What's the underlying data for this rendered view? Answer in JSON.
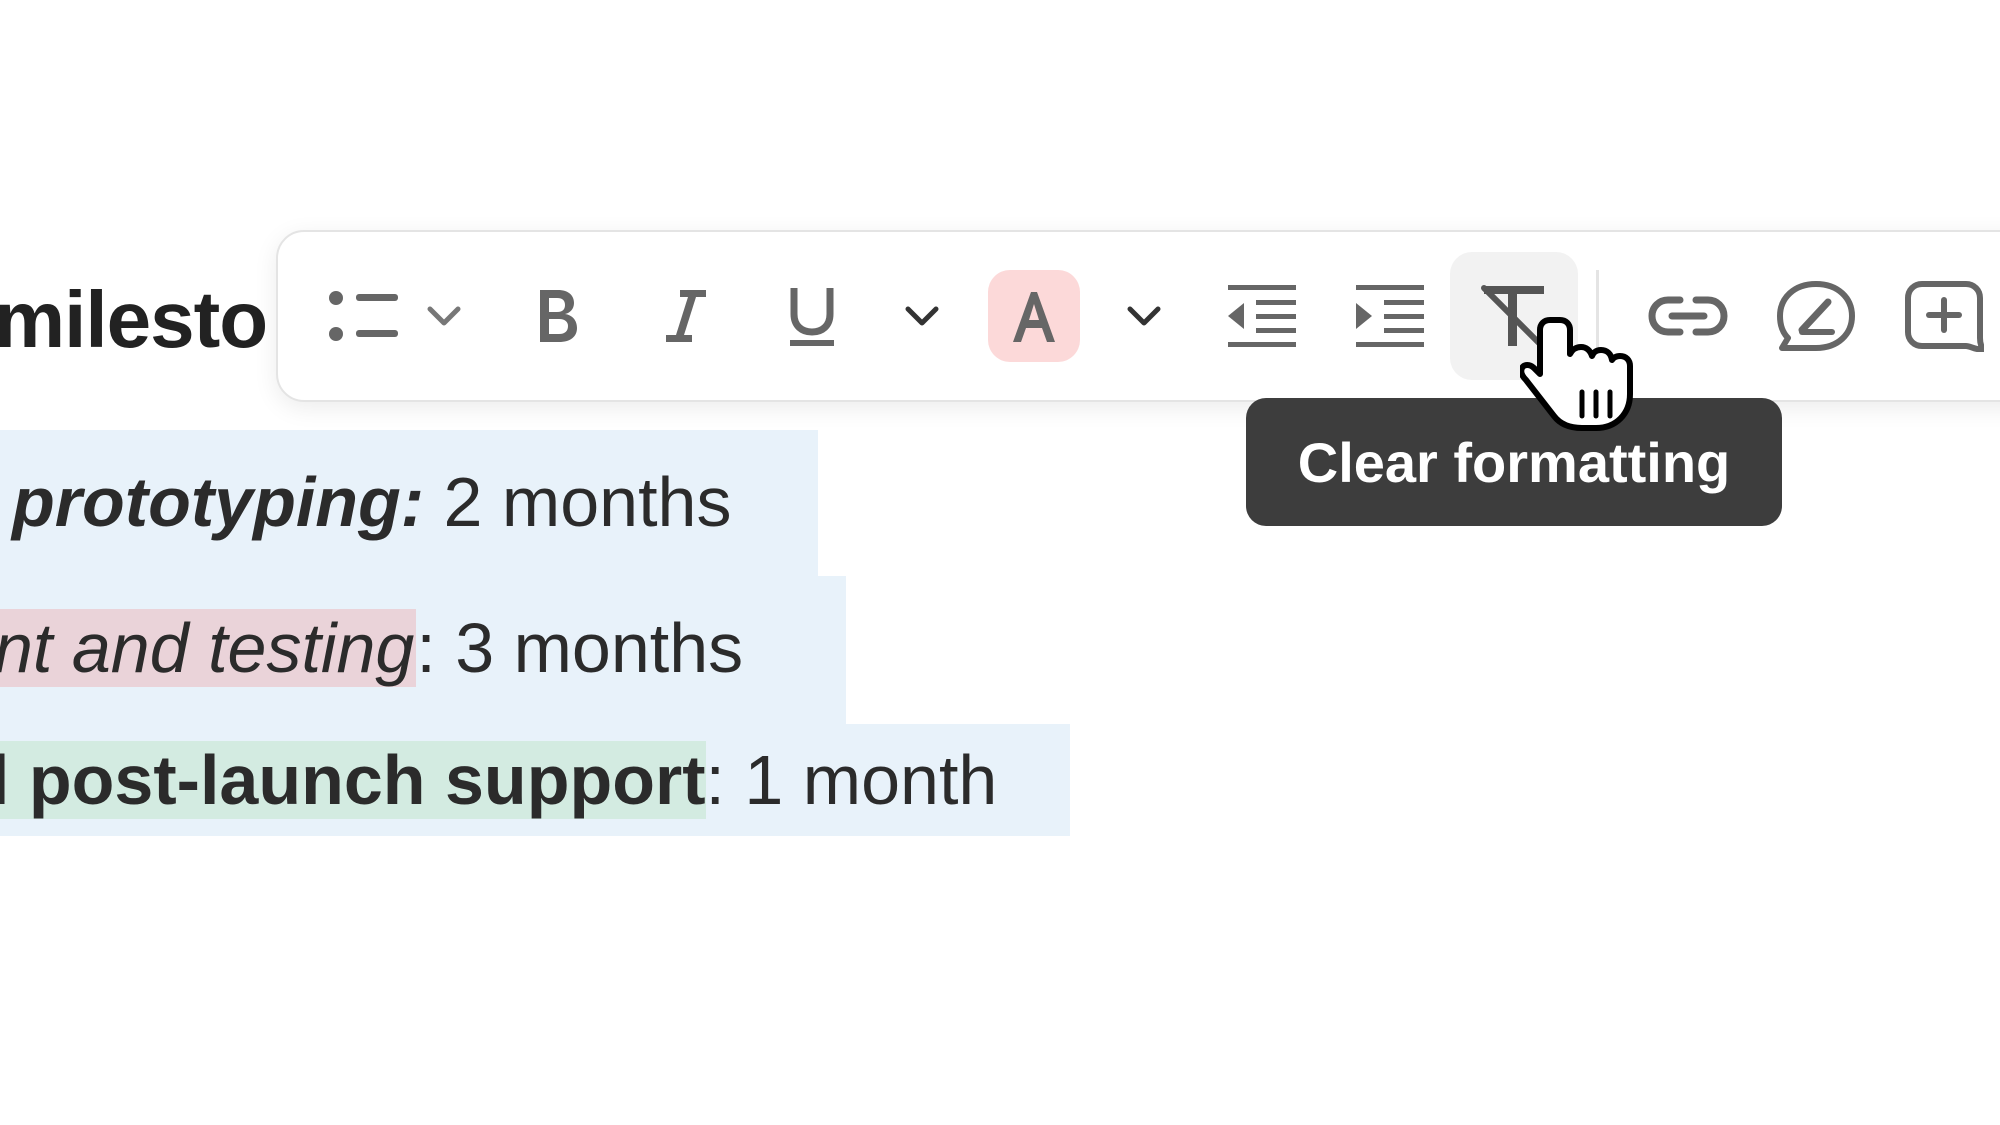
{
  "document": {
    "heading": "milesto",
    "lines": [
      {
        "label": " prototyping:",
        "value": " 2 months"
      },
      {
        "label": "nt and testing",
        "sep": ":",
        "value": " 3 months"
      },
      {
        "label": "l post-launch support",
        "sep": ":",
        "value": " 1 month"
      }
    ]
  },
  "toolbar": {
    "buttons": [
      {
        "name": "bulleted-list",
        "icon": "bullet-list-icon"
      },
      {
        "name": "list-options",
        "icon": "chevron-down-icon"
      },
      {
        "name": "bold",
        "icon": "bold-icon"
      },
      {
        "name": "italic",
        "icon": "italic-icon"
      },
      {
        "name": "underline",
        "icon": "underline-icon"
      },
      {
        "name": "text-style-options",
        "icon": "chevron-down-icon"
      },
      {
        "name": "text-color",
        "icon": "text-color-icon",
        "swatch": "#fcd9d9"
      },
      {
        "name": "text-color-options",
        "icon": "chevron-down-icon"
      },
      {
        "name": "outdent",
        "icon": "outdent-icon"
      },
      {
        "name": "indent",
        "icon": "indent-icon"
      },
      {
        "name": "clear-formatting",
        "icon": "clear-formatting-icon",
        "state": "hovered"
      },
      {
        "name": "link",
        "icon": "link-icon"
      },
      {
        "name": "comment-edit",
        "icon": "edit-bubble-icon"
      },
      {
        "name": "add-comment",
        "icon": "add-bubble-icon"
      }
    ]
  },
  "tooltip": {
    "text": "Clear formatting"
  },
  "colors": {
    "selection": "#e8f2fa",
    "highlight_pink": "#ead3d9",
    "highlight_green": "#d3ebe1",
    "tooltip_bg": "#3d3d3d",
    "text_color_swatch": "#fcd9d9"
  }
}
